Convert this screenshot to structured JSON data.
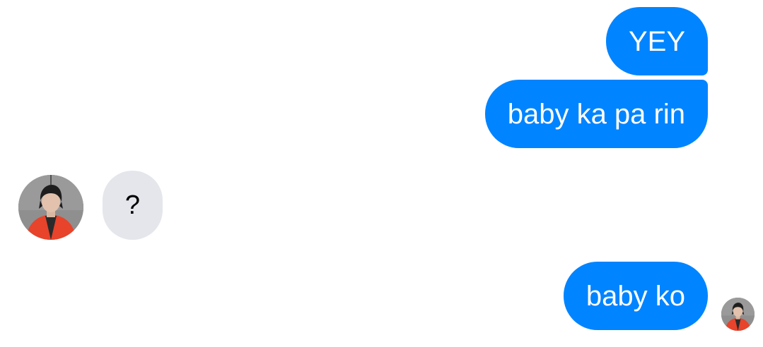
{
  "messages": [
    {
      "direction": "outgoing",
      "text": "YEY"
    },
    {
      "direction": "outgoing",
      "text": "baby ka pa rin"
    },
    {
      "direction": "incoming",
      "text": "?"
    },
    {
      "direction": "outgoing",
      "text": "baby ko"
    }
  ],
  "colors": {
    "outgoing_bubble": "#0084ff",
    "incoming_bubble": "#e4e6eb",
    "outgoing_text": "#ffffff",
    "incoming_text": "#000000",
    "background": "#ffffff"
  },
  "avatars": {
    "contact": "contact-profile-photo",
    "seen_indicator": "seen-by-contact-photo"
  }
}
